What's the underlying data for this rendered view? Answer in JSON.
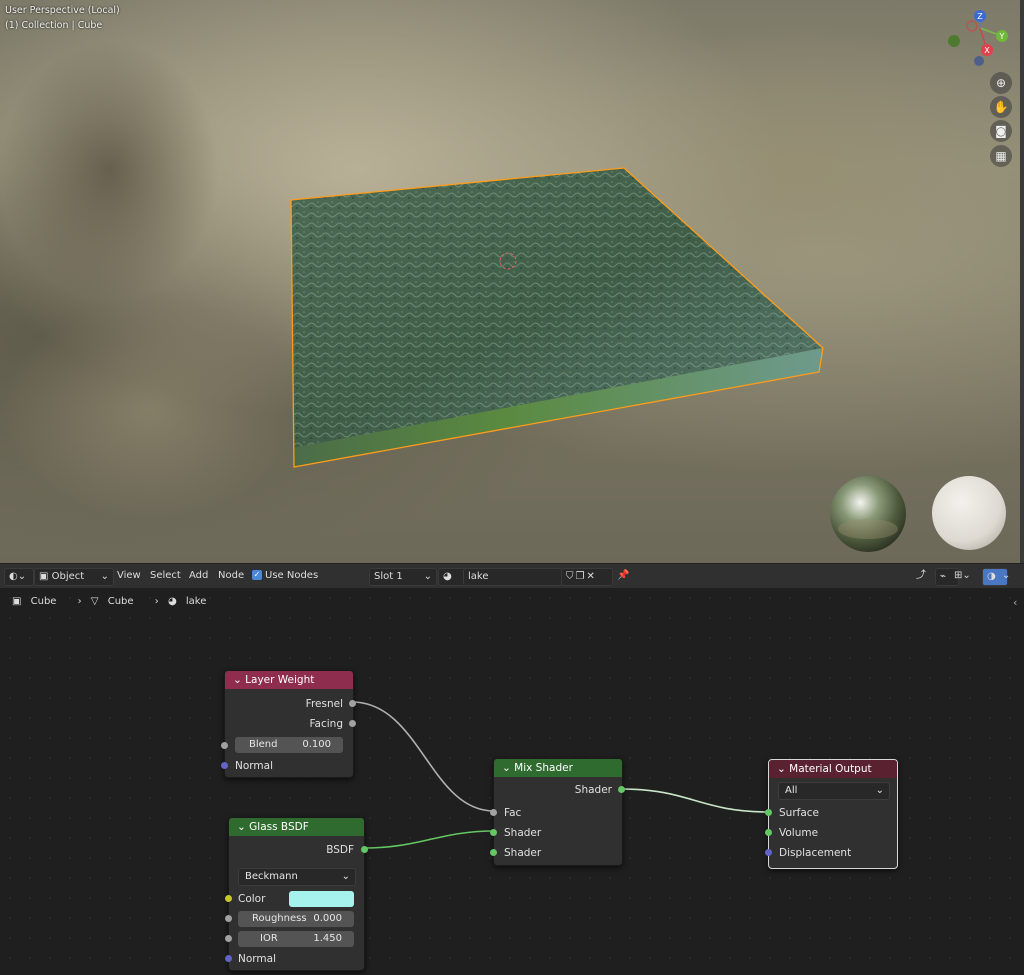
{
  "viewport": {
    "view_name": "User Perspective (Local)",
    "collection": "(1) Collection | Cube",
    "gizmo_axes": [
      "Z",
      "Y",
      "X"
    ],
    "nav_icons": [
      "zoom-icon",
      "pan-hand-icon",
      "camera-icon",
      "grid-perspective-icon"
    ]
  },
  "header": {
    "editor_type_icon": "shader-editor-icon",
    "mode": "Object",
    "menus": [
      "View",
      "Select",
      "Add",
      "Node"
    ],
    "use_nodes_label": "Use Nodes",
    "slot": "Slot 1",
    "material_name": "lake"
  },
  "breadcrumb": {
    "items": [
      "Cube",
      "Cube",
      "lake"
    ]
  },
  "nodes": {
    "layer_weight": {
      "title": "Layer Weight",
      "outputs": [
        "Fresnel",
        "Facing"
      ],
      "blend_label": "Blend",
      "blend_value": "0.100",
      "normal_label": "Normal",
      "color": "#8f2d4e"
    },
    "glass_bsdf": {
      "title": "Glass BSDF",
      "output": "BSDF",
      "distribution": "Beckmann",
      "color_label": "Color",
      "color_value": "#a6f2ec",
      "roughness_label": "Roughness",
      "roughness_value": "0.000",
      "ior_label": "IOR",
      "ior_value": "1.450",
      "normal_label": "Normal",
      "color": "#2f6b2f"
    },
    "mix_shader": {
      "title": "Mix Shader",
      "output": "Shader",
      "inputs": [
        "Fac",
        "Shader",
        "Shader"
      ],
      "color": "#2f6b2f"
    },
    "material_output": {
      "title": "Material Output",
      "target": "All",
      "inputs": [
        "Surface",
        "Volume",
        "Displacement"
      ],
      "color": "#5a2130"
    }
  },
  "colors": {
    "selection_outline": "#ff9c1a",
    "socket_shader": "#63c763",
    "socket_float": "#a1a1a1",
    "socket_vector": "#6363c7",
    "socket_color": "#c7c729"
  }
}
